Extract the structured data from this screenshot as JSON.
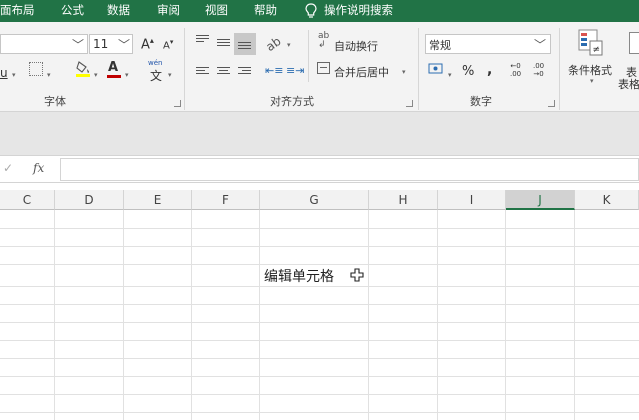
{
  "menu": {
    "tabs": [
      "面布局",
      "公式",
      "数据",
      "审阅",
      "视图",
      "帮助"
    ],
    "tell_me": "操作说明搜索"
  },
  "ribbon": {
    "font": {
      "size_value": "11",
      "grow_label": "A",
      "shrink_label": "A",
      "font_color_label": "A",
      "phonetic_label": "wén",
      "group_label": "字体"
    },
    "alignment": {
      "orientation_label": "ab",
      "wrap_text_label": "自动换行",
      "merge_center_label": "合并后居中",
      "group_label": "对齐方式"
    },
    "number": {
      "format_value": "常规",
      "percent_label": "%",
      "comma_label": ",",
      "inc_decimal_top": "←0",
      "inc_decimal_bottom": ".00",
      "dec_decimal_top": ".00",
      "dec_decimal_bottom": "→0",
      "group_label": "数字"
    },
    "styles": {
      "conditional_format_label": "条件格式",
      "table_format_label": "表",
      "table_format_label_2": "表格"
    }
  },
  "formula_bar": {
    "fx_label": "fx",
    "content": ""
  },
  "grid": {
    "columns": [
      "C",
      "D",
      "E",
      "F",
      "G",
      "H",
      "I",
      "J",
      "K"
    ],
    "selected_column": "J",
    "cell_text": "编辑单元格"
  },
  "colors": {
    "accent": "#217346",
    "ribbon_bg": "#f3f3f3",
    "grid_line": "#e1e1e1",
    "font_color_bar": "#c00000",
    "highlight_bar": "#ffff00"
  }
}
